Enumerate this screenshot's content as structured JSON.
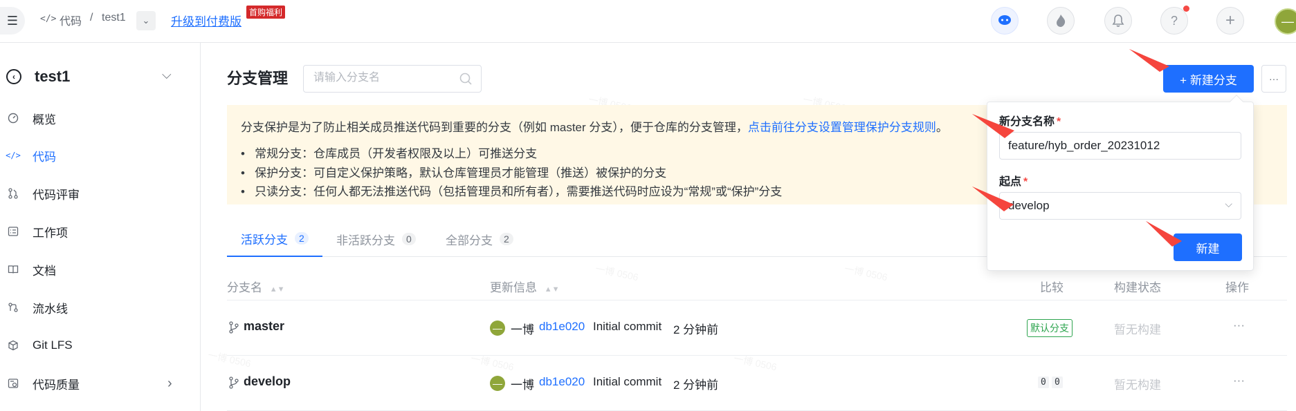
{
  "topbar": {
    "breadcrumb_section": "代码",
    "breadcrumb_sep": "/",
    "breadcrumb_repo": "test1",
    "upgrade_link": "升级到付费版",
    "promo_badge": "首购福利"
  },
  "sidebar": {
    "repo_name": "test1",
    "items": [
      {
        "label": "概览",
        "icon": "gauge-icon"
      },
      {
        "label": "代码",
        "icon": "code-icon",
        "active": true
      },
      {
        "label": "代码评审",
        "icon": "merge-request-icon"
      },
      {
        "label": "工作项",
        "icon": "checklist-icon"
      },
      {
        "label": "文档",
        "icon": "book-icon"
      },
      {
        "label": "流水线",
        "icon": "pipeline-icon"
      },
      {
        "label": "Git LFS",
        "icon": "box-icon"
      },
      {
        "label": "代码质量",
        "icon": "quality-icon"
      }
    ]
  },
  "main": {
    "title": "分支管理",
    "search_placeholder": "请输入分支名",
    "new_branch_button": "+ 新建分支",
    "more_button": "···",
    "notice": {
      "intro": "分支保护是为了防止相关成员推送代码到重要的分支（例如 master 分支），便于仓库的分支管理，",
      "intro_link": "点击前往分支设置管理保护分支规则",
      "intro_end": "。",
      "bullets": [
        "常规分支：仓库成员（开发者权限及以上）可推送分支",
        "保护分支：可自定义保护策略，默认仓库管理员才能管理（推送）被保护的分支",
        "只读分支：任何人都无法推送代码（包括管理员和所有者），需要推送代码时应设为“常规”或“保护”分支"
      ]
    },
    "tabs": [
      {
        "label": "活跃分支",
        "count": "2",
        "active": true
      },
      {
        "label": "非活跃分支",
        "count": "0"
      },
      {
        "label": "全部分支",
        "count": "2"
      }
    ],
    "columns": {
      "name": "分支名",
      "update": "更新信息",
      "compare": "比较",
      "build": "构建状态",
      "action": "操作"
    },
    "rows": [
      {
        "name": "master",
        "author": "一博",
        "commit": "db1e020",
        "message": "Initial commit",
        "time": "2 分钟前",
        "compare": "默认分支",
        "build": "暂无构建",
        "action": "···"
      },
      {
        "name": "develop",
        "author": "一博",
        "commit": "db1e020",
        "message": "Initial commit",
        "time": "2 分钟前",
        "compare_a": "0",
        "compare_b": "0",
        "build": "暂无构建",
        "action": "···"
      }
    ]
  },
  "popover": {
    "name_label": "新分支名称",
    "name_value": "feature/hyb_order_20231012",
    "source_label": "起点",
    "source_value": "develop",
    "submit": "新建"
  },
  "colors": {
    "primary": "#1e6fff",
    "notice_bg": "#fff8e6",
    "badge_red": "#d4292b",
    "default_branch_green": "#2da44e",
    "annotation_arrow": "#f5453d"
  }
}
